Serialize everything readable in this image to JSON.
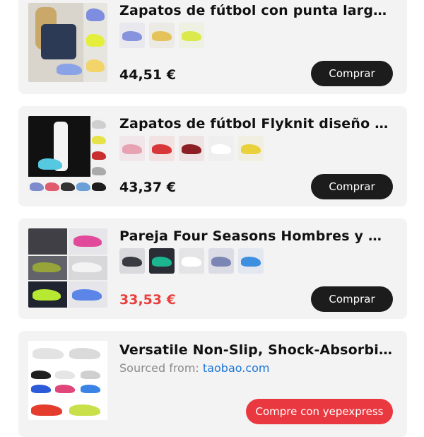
{
  "products": [
    {
      "title": "Zapatos de fútbol con punta larga b...",
      "price": "44,51 €",
      "price_color": "#111111",
      "button_label": "Comprar"
    },
    {
      "title": "Zapatos de fútbol Flyknit diseño de...",
      "price": "43,37 €",
      "price_color": "#111111",
      "button_label": "Comprar"
    },
    {
      "title": "Pareja Four Seasons Hombres y Mall...",
      "price": "33,53 €",
      "price_color": "#e8403f",
      "button_label": "Comprar"
    },
    {
      "title": "Versatile Non-Slip, Shock-Absorbin...",
      "sourced_label": "Sourced from:",
      "sourced_link": "taobao.com",
      "button_label": "Compre con yepexpress"
    }
  ],
  "colors": {
    "card_bg": "#f3f3f3",
    "button_dark": "#1c1c1c",
    "button_red": "#e9383f",
    "link_blue": "#1a73d6",
    "sale_red": "#e8403f"
  }
}
